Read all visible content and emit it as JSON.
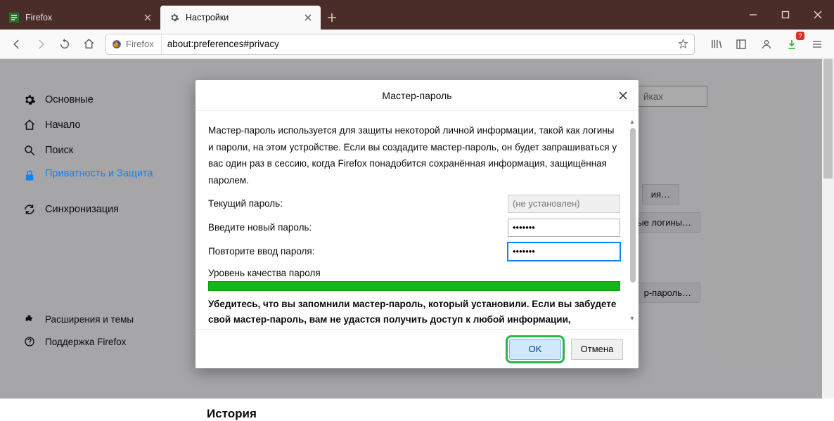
{
  "window": {
    "minimize": "min",
    "maximize": "max",
    "close": "close"
  },
  "tabs": [
    {
      "label": "Firefox",
      "active": false
    },
    {
      "label": "Настройки",
      "active": true
    }
  ],
  "urlbar": {
    "identity": "Firefox",
    "address": "about:preferences#privacy"
  },
  "toolbar_right": {
    "download_badge": "?"
  },
  "sidebar": {
    "items": [
      {
        "label": "Основные"
      },
      {
        "label": "Начало"
      },
      {
        "label": "Поиск"
      },
      {
        "label": "Приватность и Защита"
      },
      {
        "label": "Синхронизация"
      }
    ],
    "footer": [
      {
        "label": "Расширения и темы"
      },
      {
        "label": "Поддержка Firefox"
      }
    ]
  },
  "background": {
    "search_partial": "йках",
    "btn1": "ия…",
    "btn2": "ые логины…",
    "btn3": "р-пароль…",
    "history_heading": "История"
  },
  "dialog": {
    "title": "Мастер-пароль",
    "description": "Мастер-пароль используется для защиты некоторой личной информации, такой как логины и пароли, на этом устройстве. Если вы создадите мастер-пароль, он будет запрашиваться у вас один раз в сессию, когда Firefox понадобится сохранённая информация, защищённая паролем.",
    "current_label": "Текущий пароль:",
    "current_placeholder": "(не установлен)",
    "new_label": "Введите новый пароль:",
    "new_value": "•••••••",
    "repeat_label": "Повторите ввод пароля:",
    "repeat_value": "•••••••",
    "quality_label": "Уровень качества пароля",
    "warning": "Убедитесь, что вы запомнили мастер-пароль, который установили. Если вы забудете свой мастер-пароль, вам не удастся получить доступ к любой информации,",
    "ok": "OK",
    "cancel": "Отмена"
  },
  "colors": {
    "titlebar": "#4a2d28",
    "accent": "#0a84ff",
    "quality_green": "#17b517",
    "ok_highlight": "#2bb24c"
  }
}
